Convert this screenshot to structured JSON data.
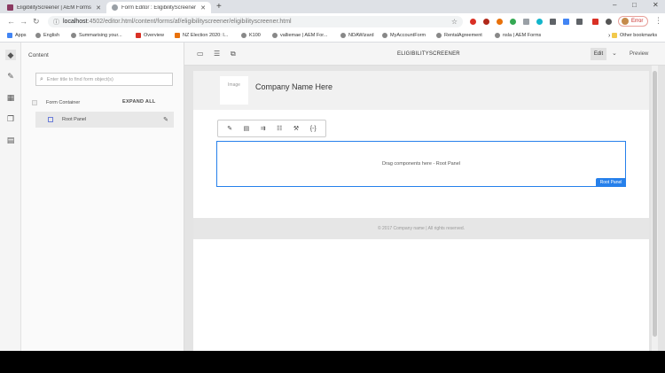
{
  "tabs": [
    {
      "title": "EligibilityScreener | AEM Forms",
      "color": "#8b3a62"
    },
    {
      "title": "Form Editor : EligibilityScreener",
      "color": "#9aa0a6"
    }
  ],
  "window_controls": {
    "minimize": "–",
    "maximize": "□",
    "close": "✕"
  },
  "address": {
    "host": "localhost",
    "path": ":4502/editor.html/content/forms/af/eligibilityscreener/eligibilityscreener.html"
  },
  "profile_pill": "Error",
  "bookmarks": [
    {
      "label": "Apps",
      "icon": "apps-icon"
    },
    {
      "label": "English",
      "icon": "globe"
    },
    {
      "label": "Summarising your...",
      "icon": "globe"
    },
    {
      "label": "Overview",
      "icon": "adobe-icon"
    },
    {
      "label": "NZ Election 2020: I...",
      "icon": "nz-icon"
    },
    {
      "label": "K100",
      "icon": "globe"
    },
    {
      "label": "valliemae | AEM For...",
      "icon": "globe"
    },
    {
      "label": "NDAWizard",
      "icon": "globe"
    },
    {
      "label": "MyAccountForm",
      "icon": "globe"
    },
    {
      "label": "RentalAgreement",
      "icon": "globe"
    },
    {
      "label": "nsla | AEM Forms",
      "icon": "globe"
    },
    {
      "label": "Other bookmarks",
      "icon": "folder-icon"
    }
  ],
  "sidepanel": {
    "title": "Content",
    "search_placeholder": "Enter title to find form object(s)",
    "tree_root": "Form Container",
    "expand_all": "EXPAND ALL",
    "selected_item": "Root Panel"
  },
  "editor": {
    "title": "ELIGIBILITYSCREENER",
    "mode": "Edit",
    "preview": "Preview"
  },
  "page": {
    "logo_text": "Image",
    "company_name": "Company Name Here",
    "drop_hint": "Drag components here - Root Panel",
    "panel_badge": "Root Panel",
    "footer": "© 2017 Company name | All rights reserved."
  },
  "toolbar_icons": [
    "wrench-icon",
    "list-icon",
    "arrow-list-icon",
    "add-list-icon",
    "rule-icon",
    "code-icon"
  ]
}
